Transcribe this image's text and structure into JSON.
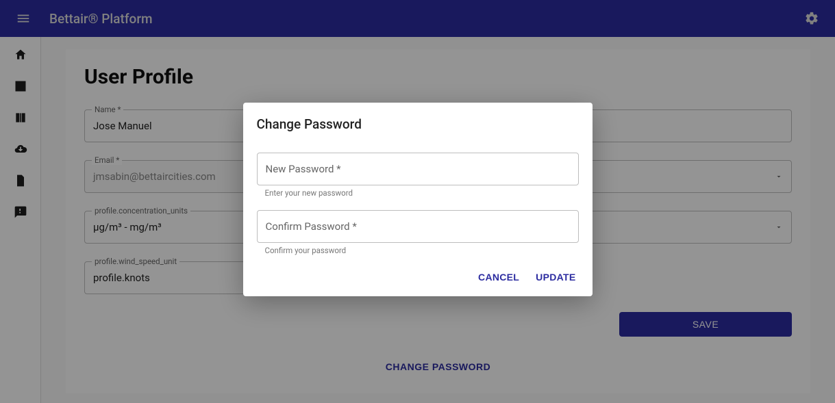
{
  "appbar": {
    "title": "Bettair® Platform"
  },
  "page": {
    "title": "User Profile"
  },
  "fields": {
    "name_label": "Name *",
    "name_value": "Jose Manuel",
    "email_label": "Email *",
    "email_value": "jmsabin@bettaircities.com",
    "lang_label": "",
    "lang_value": "",
    "conc_label": "profile.concentration_units",
    "conc_value": "μg/m³ - mg/m³",
    "temp_label": "",
    "temp_value": "",
    "wind_label": "profile.wind_speed_unit",
    "wind_value": "profile.knots"
  },
  "buttons": {
    "save": "SAVE",
    "change_password": "CHANGE PASSWORD"
  },
  "dialog": {
    "title": "Change Password",
    "new_pw_label": "New Password *",
    "new_pw_helper": "Enter your new password",
    "confirm_pw_label": "Confirm Password *",
    "confirm_pw_helper": "Confirm your password",
    "cancel": "CANCEL",
    "update": "UPDATE"
  }
}
